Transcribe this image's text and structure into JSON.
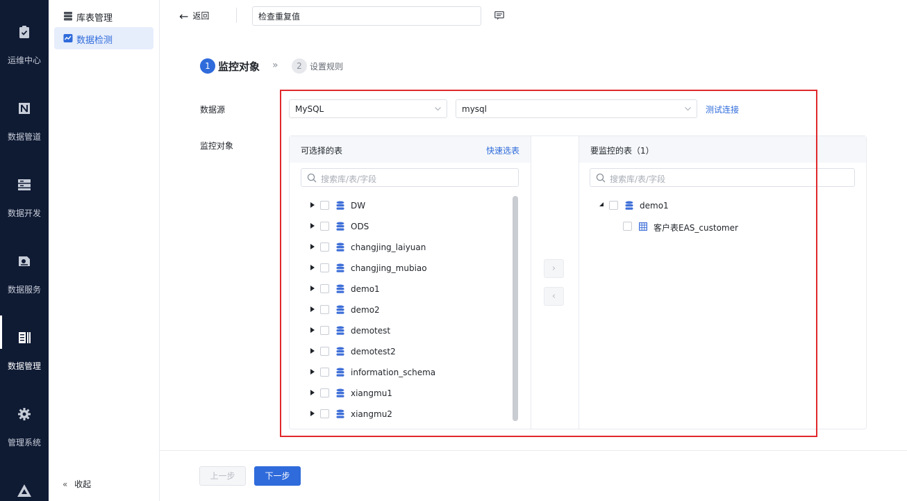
{
  "rail": {
    "items": [
      {
        "label": "运维中心",
        "icon": "clipboard-check-icon"
      },
      {
        "label": "数据管道",
        "icon": "pipeline-icon"
      },
      {
        "label": "数据开发",
        "icon": "server-stack-icon"
      },
      {
        "label": "数据服务",
        "icon": "data-service-icon"
      },
      {
        "label": "数据管理",
        "icon": "data-management-icon"
      },
      {
        "label": "管理系统",
        "icon": "gear-icon"
      }
    ],
    "active_index": 4
  },
  "menu": {
    "items": [
      {
        "label": "库表管理",
        "icon": "table-stack-icon"
      },
      {
        "label": "数据检测",
        "icon": "monitor-chart-icon"
      }
    ],
    "active_index": 1,
    "collapse_label": "收起"
  },
  "topbar": {
    "back_label": "返回",
    "title_value": "检查重复值"
  },
  "steps": {
    "step1": {
      "num": "1",
      "label": "监控对象"
    },
    "step2": {
      "num": "2",
      "label": "设置规则"
    }
  },
  "form": {
    "datasource_label": "数据源",
    "datasource_type": "MySQL",
    "datasource_name": "mysql",
    "test_connection": "测试连接",
    "monitor_label": "监控对象"
  },
  "transfer": {
    "left": {
      "title": "可选择的表",
      "quick_select": "快速选表",
      "search_placeholder": "搜索库/表/字段",
      "items": [
        "DW",
        "ODS",
        "changjing_laiyuan",
        "changjing_mubiao",
        "demo1",
        "demo2",
        "demotest",
        "demotest2",
        "information_schema",
        "xiangmu1",
        "xiangmu2"
      ]
    },
    "right": {
      "title": "要监控的表（1）",
      "search_placeholder": "搜索库/表/字段",
      "db": "demo1",
      "table": "客户表EAS_customer"
    },
    "move_right": "›",
    "move_left": "‹"
  },
  "footer": {
    "prev": "上一步",
    "next": "下一步"
  },
  "colors": {
    "rail_bg": "#0f1a33",
    "primary": "#2f6bdb",
    "highlight": "#e1282b"
  }
}
